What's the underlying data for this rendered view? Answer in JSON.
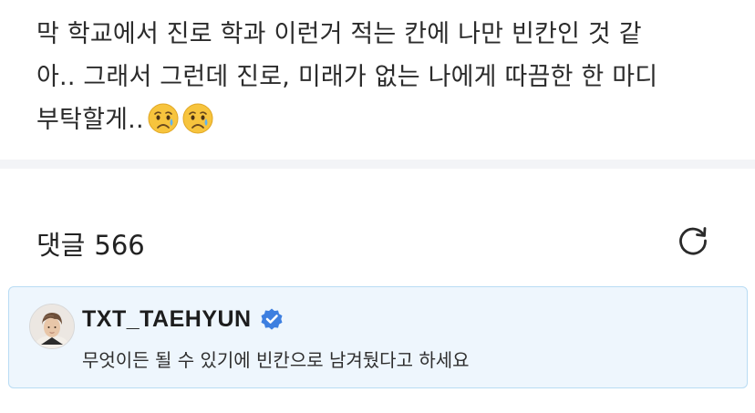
{
  "post": {
    "lines": [
      "막 학교에서 진로 학과 이런거 적는 칸에 나만 빈칸인 것 같",
      "아.. 그래서 그런데 진로, 미래가 없는 나에게 따끔한 한 마디",
      "부탁할게.."
    ],
    "emojis": [
      "crying-face",
      "crying-face"
    ]
  },
  "comments": {
    "label": "댓글",
    "count": "566",
    "refresh_icon": "refresh-icon"
  },
  "pinned_comment": {
    "author": "TXT_TAEHYUN",
    "verified": true,
    "text": "무엇이든 될 수 있기에 빈칸으로 남겨뒀다고 하세요",
    "colors": {
      "card_bg": "#eef6fd",
      "card_border": "#b9dcf4",
      "verified_badge": "#3d7fe0"
    }
  }
}
